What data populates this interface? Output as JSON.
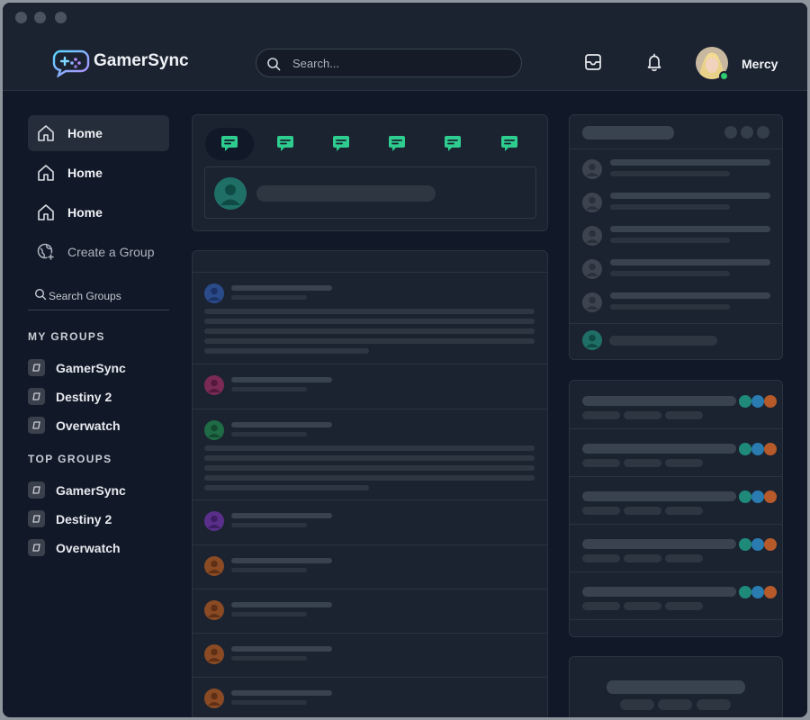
{
  "app": {
    "brand": "GamerSync"
  },
  "header": {
    "search_placeholder": "Search...",
    "user_name": "Mercy",
    "icons": [
      "inbox-icon",
      "bell-icon"
    ]
  },
  "sidebar": {
    "nav": [
      {
        "label": "Home",
        "icon": "home-icon",
        "active": true
      },
      {
        "label": "Home",
        "icon": "home-icon",
        "active": false
      },
      {
        "label": "Home",
        "icon": "home-icon",
        "active": false
      },
      {
        "label": "Create a Group",
        "icon": "globe-plus-icon",
        "active": false
      }
    ],
    "search_label": "Search Groups",
    "my_groups_title": "MY GROUPS",
    "my_groups": [
      {
        "name": "GamerSync"
      },
      {
        "name": "Destiny 2"
      },
      {
        "name": "Overwatch"
      }
    ],
    "top_groups_title": "TOP GROUPS",
    "top_groups": [
      {
        "name": "GamerSync"
      },
      {
        "name": "Destiny 2"
      },
      {
        "name": "Overwatch"
      }
    ]
  },
  "colors": {
    "accent": "#2ecc8f",
    "background": "#111827",
    "panel": "#1b2330",
    "online": "#2ecc71"
  }
}
